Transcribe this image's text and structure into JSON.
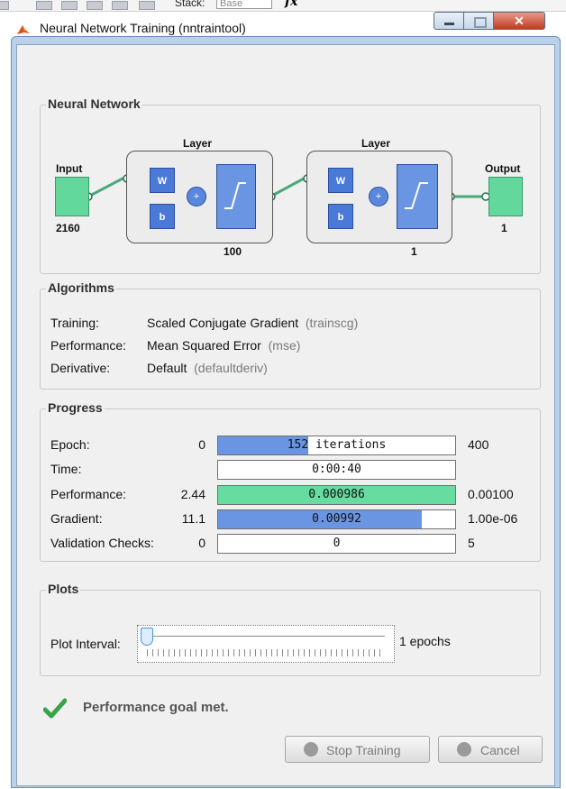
{
  "toolbar": {
    "stack_label": "Stack:",
    "stack_value": "Base",
    "fx_label": "fx"
  },
  "window": {
    "title": "Neural Network Training (nntraintool)"
  },
  "network": {
    "group_title": "Neural Network",
    "input_label": "Input",
    "input_size": "2160",
    "layer1": {
      "title": "Layer",
      "w": "W",
      "b": "b",
      "size": "100"
    },
    "layer2": {
      "title": "Layer",
      "w": "W",
      "b": "b",
      "size": "1"
    },
    "output_label": "Output",
    "output_size": "1"
  },
  "algorithms": {
    "group_title": "Algorithms",
    "rows": [
      {
        "label": "Training:",
        "value": "Scaled Conjugate Gradient",
        "param": "(trainscg)"
      },
      {
        "label": "Performance:",
        "value": "Mean Squared Error",
        "param": "(mse)"
      },
      {
        "label": "Derivative:",
        "value": "Default",
        "param": "(defaultderiv)"
      }
    ]
  },
  "progress": {
    "group_title": "Progress",
    "rows": [
      {
        "label": "Epoch:",
        "start": "0",
        "bar_text": "152 iterations",
        "end": "400",
        "fill": 0.38,
        "fill_color": "#6a95e2"
      },
      {
        "label": "Time:",
        "start": "",
        "bar_text": "0:00:40",
        "end": "",
        "fill": 0,
        "fill_color": "#6a95e2"
      },
      {
        "label": "Performance:",
        "start": "2.44",
        "bar_text": "0.000986",
        "end": "0.00100",
        "fill": 1.0,
        "fill_color": "#66dca0"
      },
      {
        "label": "Gradient:",
        "start": "11.1",
        "bar_text": "0.00992",
        "end": "1.00e-06",
        "fill": 0.86,
        "fill_color": "#6a95e2"
      },
      {
        "label": "Validation Checks:",
        "start": "0",
        "bar_text": "0",
        "end": "5",
        "fill": 0,
        "fill_color": "#6a95e2"
      }
    ]
  },
  "plots": {
    "group_title": "Plots",
    "interval_label": "Plot Interval:",
    "interval_value": "1 epochs",
    "slider_level": 0
  },
  "status": {
    "message": "Performance goal met."
  },
  "buttons": {
    "stop": "Stop Training",
    "cancel": "Cancel"
  },
  "colors": {
    "title_bar": "#b9d1ea",
    "close_button": "#c9503e",
    "input_green": "#62d89c",
    "neuron_blue": "#4a79d8"
  }
}
